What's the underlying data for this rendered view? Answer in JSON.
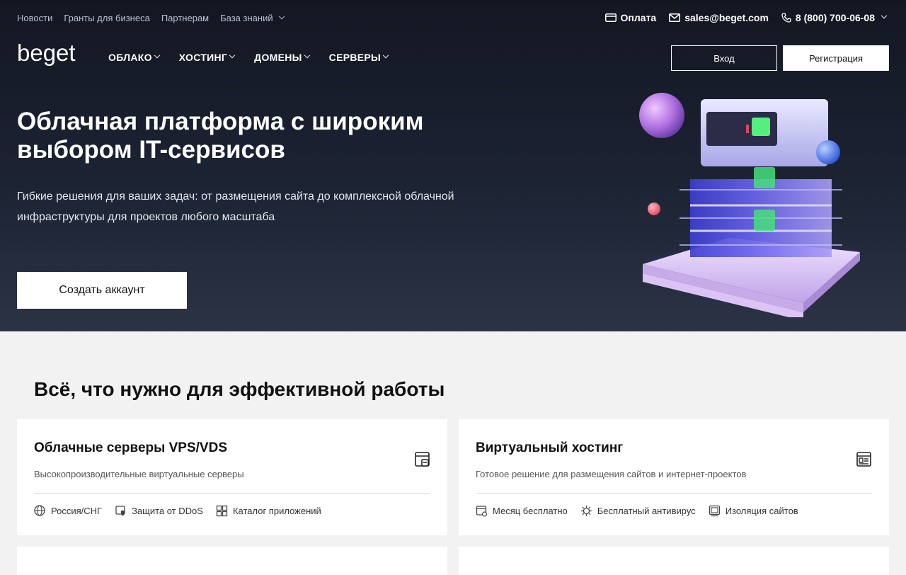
{
  "top_nav": {
    "links": [
      "Новости",
      "Гранты для бизнеса",
      "Партнерам",
      "База знаний"
    ],
    "payment": "Оплата",
    "email": "sales@beget.com",
    "phone": "8 (800) 700-06-08"
  },
  "logo": {
    "text": "beget"
  },
  "main_nav": {
    "items": [
      "ОБЛАКО",
      "ХОСТИНГ",
      "ДОМЕНЫ",
      "СЕРВЕРЫ"
    ]
  },
  "auth": {
    "login": "Вход",
    "register": "Регистрация"
  },
  "hero": {
    "title": "Облачная платформа с широким выбором IT-сервисов",
    "subtitle": "Гибкие решения для ваших задач: от размещения сайта до комплексной облачной инфраструктуры для проектов любого масштаба",
    "cta": "Создать аккаунт"
  },
  "section": {
    "title": "Всё, что нужно для эффективной работы"
  },
  "cards": [
    {
      "title": "Облачные серверы VPS/VDS",
      "desc": "Высокопроизводительные виртуальные серверы",
      "icon": "server-window-icon",
      "features": [
        "Россия/СНГ",
        "Защита от DDoS",
        "Каталог приложений"
      ]
    },
    {
      "title": "Виртуальный хостинг",
      "desc": "Готовое решение для размещения сайтов и интернет-проектов",
      "icon": "hosting-window-icon",
      "features": [
        "Месяц бесплатно",
        "Бесплатный антивирус",
        "Изоляция сайтов"
      ]
    }
  ],
  "colors": {
    "hero_bg": "#1c2333",
    "accent_purple": "#8a6cf0",
    "led_green": "#43e06a"
  }
}
